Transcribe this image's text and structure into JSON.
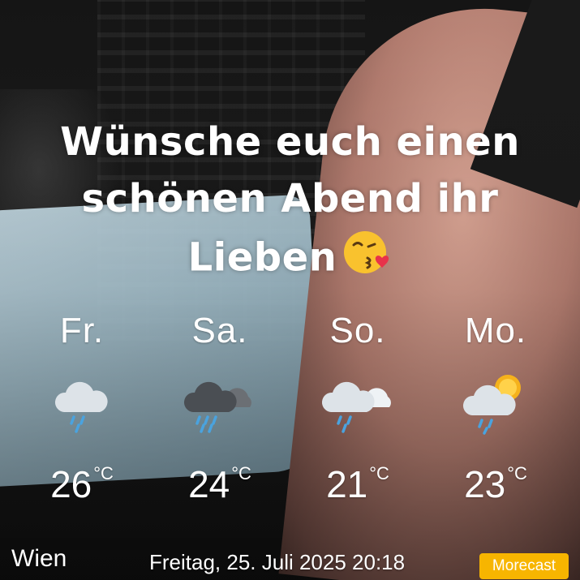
{
  "caption": {
    "line1": "Wünsche euch einen",
    "line2": "schönen Abend ihr",
    "line3": "Lieben"
  },
  "forecast": [
    {
      "day": "Fr.",
      "temp": "26",
      "unit": "°C",
      "icon": "rain-cloud-icon"
    },
    {
      "day": "Sa.",
      "temp": "24",
      "unit": "°C",
      "icon": "heavy-rain-cloud-icon"
    },
    {
      "day": "So.",
      "temp": "21",
      "unit": "°C",
      "icon": "rain-cloud-icon"
    },
    {
      "day": "Mo.",
      "temp": "23",
      "unit": "°C",
      "icon": "sun-rain-cloud-icon"
    }
  ],
  "footer": {
    "city": "Wien",
    "datetime": "Freitag, 25. Juli 2025 20:18",
    "brand": "Morecast"
  },
  "colors": {
    "brand_badge": "#f7b500",
    "text": "#ffffff",
    "rain": "#4aa3df",
    "sun": "#f5b21c"
  }
}
